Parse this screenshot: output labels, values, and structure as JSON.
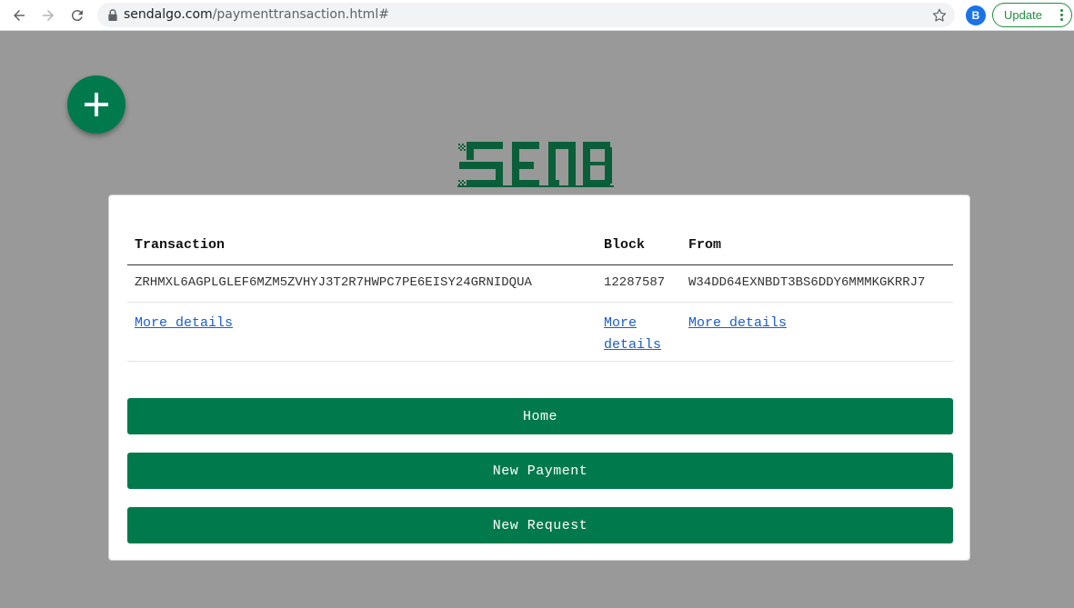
{
  "browser": {
    "url_domain": "sendalgo.com",
    "url_path": "/paymenttransaction.html#",
    "profile_initial": "B",
    "update_label": "Update"
  },
  "colors": {
    "brand_green": "#007a4d",
    "link_blue": "#1a5fd0"
  },
  "icons": {
    "fab": "plus-icon",
    "logo": "send-logo"
  },
  "table": {
    "headers": [
      "Transaction",
      "Block",
      "From"
    ],
    "values": [
      "ZRHMXL6AGPLGLEF6MZM5ZVHYJ3T2R7HWPC7PE6EISY24GRNIDQUA",
      "12287587",
      "W34DD64EXNBDT3BS6DDY6MMMKGKRRJ7"
    ],
    "links": [
      "More details",
      "More details",
      "More details"
    ]
  },
  "buttons": {
    "home": "Home",
    "new_payment": "New Payment",
    "new_request": "New Request"
  }
}
